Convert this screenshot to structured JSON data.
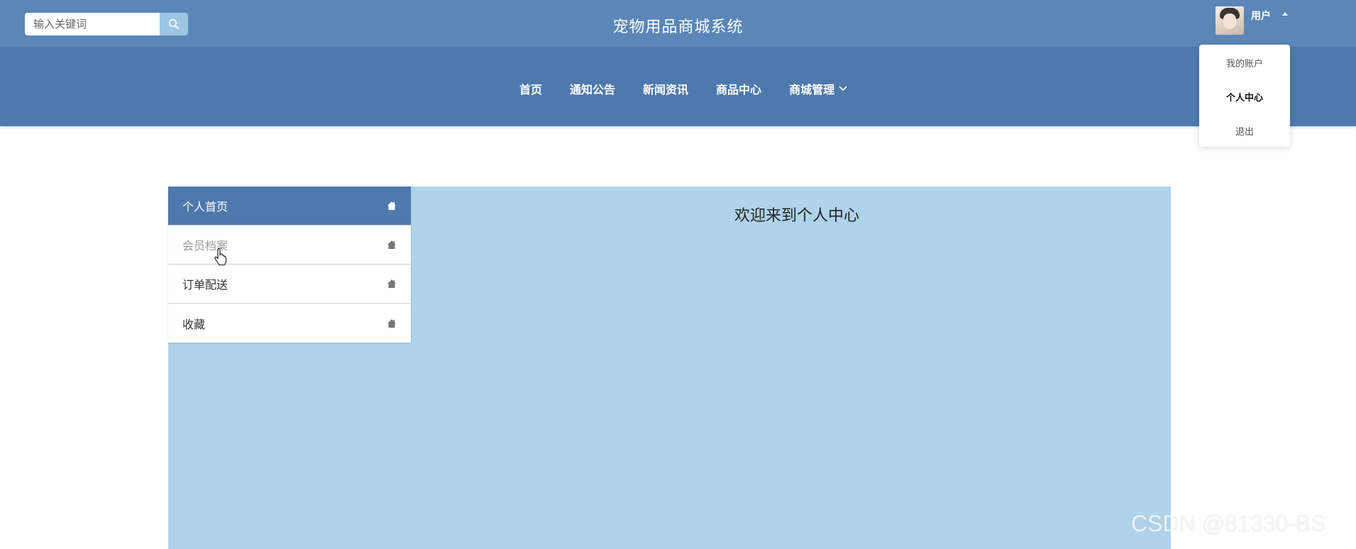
{
  "header": {
    "search": {
      "placeholder": "输入关键词",
      "value": ""
    },
    "site_title": "宠物用品商城系统",
    "user": {
      "name": "用户"
    }
  },
  "nav": {
    "items": [
      {
        "label": "首页"
      },
      {
        "label": "通知公告"
      },
      {
        "label": "新闻资讯"
      },
      {
        "label": "商品中心"
      },
      {
        "label": "商城管理"
      }
    ]
  },
  "user_menu": {
    "items": [
      {
        "label": "我的账户"
      },
      {
        "label": "个人中心"
      },
      {
        "label": "退出"
      }
    ],
    "active": "个人中心"
  },
  "sidebar": {
    "items": [
      {
        "label": "个人首页"
      },
      {
        "label": "会员档案"
      },
      {
        "label": "订单配送"
      },
      {
        "label": "收藏"
      }
    ],
    "active": "个人首页",
    "hovered": "会员档案"
  },
  "main": {
    "welcome": "欢迎来到个人中心"
  },
  "watermark": "CSDN @81330-BS",
  "colors": {
    "topbar": "#5b86b8",
    "navbar": "#4d79ad",
    "panel": "#aed3ea",
    "search_button": "#9cc6e4"
  },
  "icons": {
    "search": "search-icon",
    "side": "home-icon",
    "nav_dropdown": "chevron-down-icon",
    "user_menu": "caret-up-icon"
  }
}
